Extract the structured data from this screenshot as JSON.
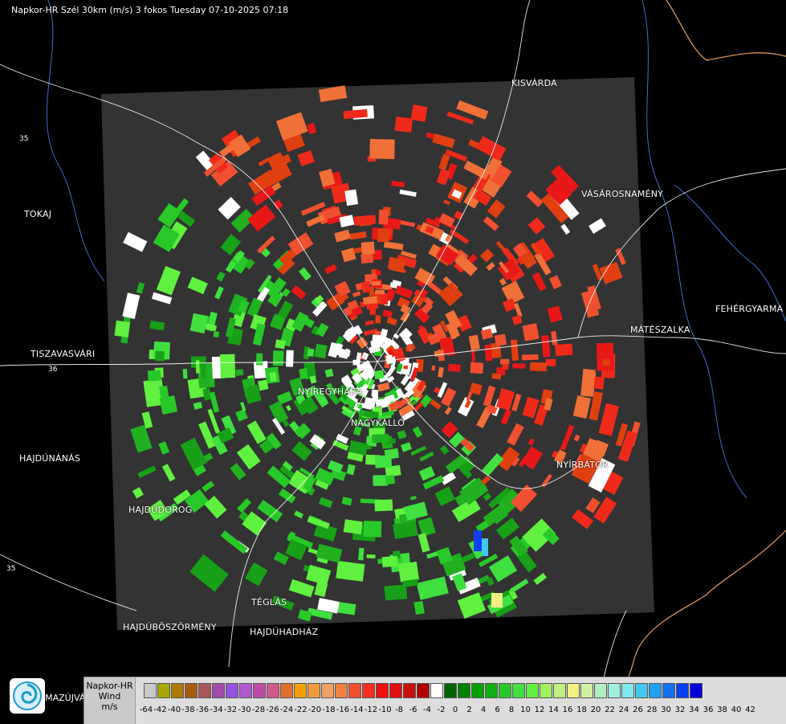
{
  "header": {
    "title": "Napkor-HR Szél 30km (m/s) 3 fokos Tuesday 07-10-2025 07:18"
  },
  "map": {
    "cities": [
      {
        "id": "kisvarda",
        "name": "KISVÁRDA"
      },
      {
        "id": "tokaj",
        "name": "TOKAJ"
      },
      {
        "id": "vasarosnameny",
        "name": "VÁSÁROSNAMÉNY"
      },
      {
        "id": "fehergyarmat",
        "name": "FEHÉRGYARMA"
      },
      {
        "id": "mateszalka",
        "name": "MÁTÉSZALKA"
      },
      {
        "id": "tiszavasvari",
        "name": "TISZAVASVÁRI"
      },
      {
        "id": "nyiregyhaza",
        "name": "NYÍREGYHÁZA"
      },
      {
        "id": "nagykallo",
        "name": "NAGYKÁLLÓ"
      },
      {
        "id": "hajdunanas",
        "name": "HAJDÚNÁNÁS"
      },
      {
        "id": "nyirbator",
        "name": "NYÍRBÁTOR"
      },
      {
        "id": "hajdudorog",
        "name": "HAJDÚDOROG"
      },
      {
        "id": "teglas",
        "name": "TÉGLÁS"
      },
      {
        "id": "hajduboszormeny",
        "name": "HAJDÚBÖSZÖRMÉNY"
      },
      {
        "id": "hajduhadhaz",
        "name": "HAJDÚHADHÁZ"
      },
      {
        "id": "almazujvar",
        "name": "LMAZÚJVÁR"
      }
    ],
    "road_numbers": [
      {
        "id": "r35a",
        "label": "35"
      },
      {
        "id": "r36",
        "label": "36"
      },
      {
        "id": "r35b",
        "label": "35"
      }
    ]
  },
  "legend": {
    "label_line1": "Napkor-HR",
    "label_line2": "Wind",
    "label_line3": "m/s",
    "colors": [
      "#c8c8c8",
      "#a8a800",
      "#b07a00",
      "#a85c10",
      "#a85858",
      "#a04ca8",
      "#9650e0",
      "#b05ad0",
      "#c04aa8",
      "#d05a8a",
      "#e07030",
      "#f5a000",
      "#f09a40",
      "#f0a060",
      "#f08040",
      "#f05030",
      "#f53020",
      "#f01010",
      "#e01010",
      "#c81010",
      "#b00000",
      "#ffffff",
      "#006400",
      "#008200",
      "#00a000",
      "#10b010",
      "#28c828",
      "#40e040",
      "#60f040",
      "#a0f060",
      "#c0f080",
      "#f0f080",
      "#d0f0a0",
      "#b0f0c0",
      "#a0f0e0",
      "#80e8f0",
      "#40c8f0",
      "#20a0f0",
      "#1070f0",
      "#0040f0",
      "#0000d8"
    ],
    "ticks": [
      "-64",
      "-42",
      "-40",
      "-38",
      "-36",
      "-34",
      "-32",
      "-30",
      "-28",
      "-26",
      "-24",
      "-22",
      "-20",
      "-18",
      "-16",
      "-14",
      "-12",
      "-10",
      "-8",
      "-6",
      "-4",
      "-2",
      "0",
      "2",
      "4",
      "6",
      "8",
      "10",
      "12",
      "14",
      "16",
      "18",
      "20",
      "22",
      "24",
      "26",
      "28",
      "30",
      "32",
      "34",
      "36",
      "38",
      "40",
      "42"
    ]
  },
  "colors": {
    "background": "#000000",
    "radar_area": "#303030",
    "outflow": "#f02a1a",
    "inflow": "#28c828"
  }
}
